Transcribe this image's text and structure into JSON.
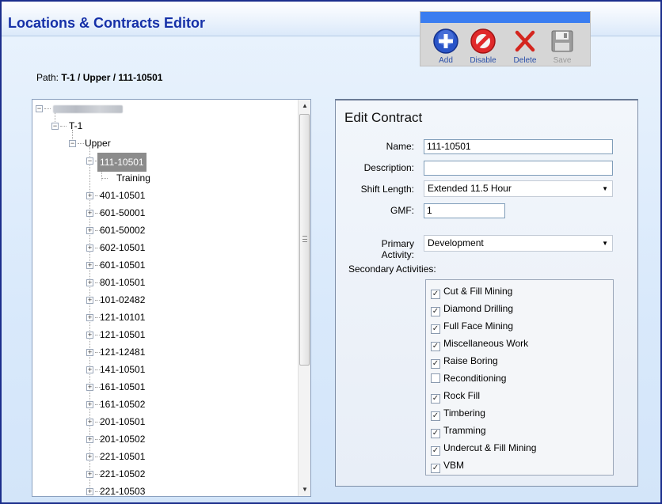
{
  "app": {
    "title": "Locations & Contracts Editor"
  },
  "toolbar": {
    "add": "Add",
    "disable": "Disable",
    "delete": "Delete",
    "save": "Save"
  },
  "path": {
    "label": "Path:",
    "value": "T-1 / Upper / 111-10501"
  },
  "tree": {
    "level1": "T-1",
    "level2": "Upper",
    "selected": "111-10501",
    "selected_child": "Training",
    "items": [
      "401-10501",
      "601-50001",
      "601-50002",
      "602-10501",
      "601-10501",
      "801-10501",
      "101-02482",
      "121-10101",
      "121-10501",
      "121-12481",
      "141-10501",
      "161-10501",
      "161-10502",
      "201-10501",
      "201-10502",
      "221-10501",
      "221-10502",
      "221-10503"
    ]
  },
  "edit": {
    "title": "Edit Contract",
    "name_label": "Name:",
    "name_value": "111-10501",
    "description_label": "Description:",
    "description_value": "",
    "shift_label": "Shift Length:",
    "shift_value": "Extended 11.5 Hour",
    "gmf_label": "GMF:",
    "gmf_value": "1",
    "primary_label": "Primary Activity:",
    "primary_value": "Development",
    "secondary_label": "Secondary Activities:",
    "activities": [
      {
        "label": "Cut & Fill Mining",
        "checked": true
      },
      {
        "label": "Diamond Drilling",
        "checked": true
      },
      {
        "label": "Full Face Mining",
        "checked": true
      },
      {
        "label": "Miscellaneous Work",
        "checked": true
      },
      {
        "label": "Raise Boring",
        "checked": true
      },
      {
        "label": "Reconditioning",
        "checked": false
      },
      {
        "label": "Rock Fill",
        "checked": true
      },
      {
        "label": "Timbering",
        "checked": true
      },
      {
        "label": "Tramming",
        "checked": true
      },
      {
        "label": "Undercut & Fill Mining",
        "checked": true
      },
      {
        "label": "VBM",
        "checked": true
      }
    ]
  },
  "colors": {
    "title": "#1530a8",
    "accent": "#3a7df0",
    "window_border": "#1c2e8c"
  }
}
